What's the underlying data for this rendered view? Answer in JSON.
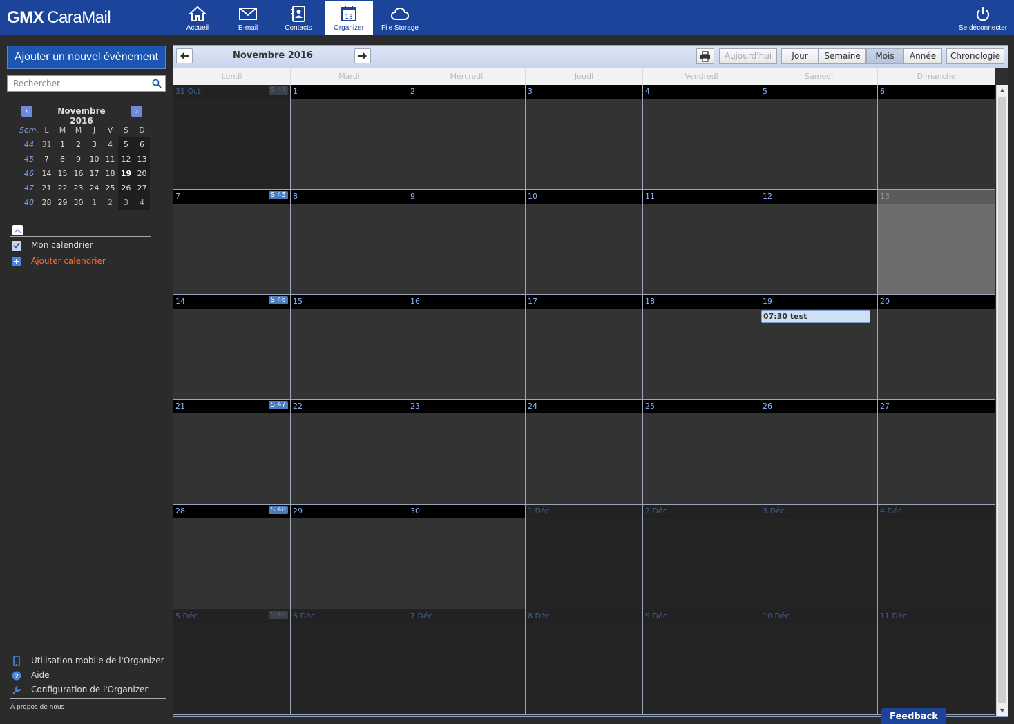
{
  "brand": {
    "logo_text": "GMX",
    "name": "CaraMail"
  },
  "nav": {
    "items": [
      {
        "label": "Accueil",
        "icon": "home-icon"
      },
      {
        "label": "E-mail",
        "icon": "mail-icon"
      },
      {
        "label": "Contacts",
        "icon": "contacts-icon"
      },
      {
        "label": "Organizer",
        "icon": "calendar-icon",
        "active": true,
        "icon_text": "13"
      },
      {
        "label": "File Storage",
        "icon": "cloud-icon"
      }
    ],
    "logout_label": "Se déconnecter"
  },
  "sidebar": {
    "add_event_label": "Ajouter un nouvel évènement",
    "search_placeholder": "Rechercher",
    "mini_calendar": {
      "title": "Novembre 2016",
      "week_col_header": "Sem.",
      "day_headers": [
        "L",
        "M",
        "M",
        "J",
        "V",
        "S",
        "D"
      ],
      "weeks": [
        {
          "week": "44",
          "days": [
            "31",
            "1",
            "2",
            "3",
            "4",
            "5",
            "6"
          ]
        },
        {
          "week": "45",
          "days": [
            "7",
            "8",
            "9",
            "10",
            "11",
            "12",
            "13"
          ]
        },
        {
          "week": "46",
          "days": [
            "14",
            "15",
            "16",
            "17",
            "18",
            "19",
            "20"
          ]
        },
        {
          "week": "47",
          "days": [
            "21",
            "22",
            "23",
            "24",
            "25",
            "26",
            "27"
          ]
        },
        {
          "week": "48",
          "days": [
            "28",
            "29",
            "30",
            "1",
            "2",
            "3",
            "4"
          ]
        }
      ]
    },
    "calendars": [
      {
        "label": "Mon calendrier",
        "checked": true
      }
    ],
    "add_calendar_label": "Ajouter calendrier",
    "footer_links": [
      {
        "label": "Utilisation mobile de l'Organizer",
        "icon": "phone-icon"
      },
      {
        "label": "Aide",
        "icon": "help-icon"
      },
      {
        "label": "Configuration de l'Organizer",
        "icon": "wrench-icon"
      }
    ],
    "about_label": "À propos de nous"
  },
  "calendar": {
    "month_label": "Novembre 2016",
    "today_button": "Aujourd'hui",
    "views": [
      "Jour",
      "Semaine",
      "Mois",
      "Année"
    ],
    "active_view": "Mois",
    "timeline_button": "Chronologie",
    "weekday_headers": [
      "Lundi",
      "Mardi",
      "Mercredi",
      "Jeudi",
      "Vendredi",
      "Samedi",
      "Dimanche"
    ],
    "weeks": [
      {
        "badge": "S 44",
        "days": [
          "31 Oct.",
          "1",
          "2",
          "3",
          "4",
          "5",
          "6"
        ]
      },
      {
        "badge": "S 45",
        "days": [
          "7",
          "8",
          "9",
          "10",
          "11",
          "12",
          "13"
        ]
      },
      {
        "badge": "S 46",
        "days": [
          "14",
          "15",
          "16",
          "17",
          "18",
          "19",
          "20"
        ]
      },
      {
        "badge": "S 47",
        "days": [
          "21",
          "22",
          "23",
          "24",
          "25",
          "26",
          "27"
        ]
      },
      {
        "badge": "S 48",
        "days": [
          "28",
          "29",
          "30",
          "1 Déc.",
          "2 Déc.",
          "3 Déc.",
          "4 Déc."
        ]
      },
      {
        "badge": "S 49",
        "days": [
          "5 Déc.",
          "6 Déc.",
          "7 Déc.",
          "8 Déc.",
          "9 Déc.",
          "10 Déc.",
          "11 Déc."
        ]
      }
    ],
    "events": [
      {
        "week": 2,
        "day": 5,
        "label": "07:30 test"
      }
    ]
  },
  "feedback_label": "Feedback",
  "colors": {
    "topbar": "#1c449b",
    "accent": "#1c56b3",
    "add_calendar": "#ff6b2b",
    "day_number": "#8bb5ff"
  }
}
